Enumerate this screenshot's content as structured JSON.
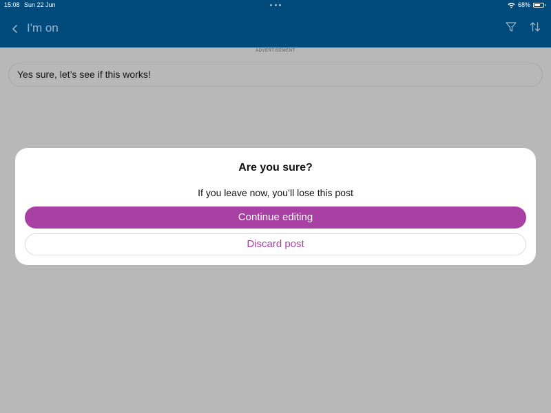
{
  "status_bar": {
    "time": "15:08",
    "date": "Sun 22 Jun",
    "battery": "68%",
    "battery_level": 0.68,
    "wifi_icon": "wifi-icon",
    "battery_icon": "battery-icon",
    "dots_icon": "multitasking-dots-icon"
  },
  "nav": {
    "title": "I'm on",
    "back_icon": "chevron-left-icon",
    "filter_icon": "filter-icon",
    "sort_icon": "sort-arrows-icon"
  },
  "content": {
    "ad_label": "ADVERTISEMENT",
    "post_text": "Yes sure, let’s see if this works!"
  },
  "dialog": {
    "title": "Are you sure?",
    "message": "If you leave now, you’ll lose this post",
    "continue_label": "Continue editing",
    "discard_label": "Discard post"
  },
  "colors": {
    "header_bg": "#004a7c",
    "accent": "#a940a3",
    "overlay_bg": "#b8b8b8",
    "nav_title": "#9cb4c8"
  }
}
